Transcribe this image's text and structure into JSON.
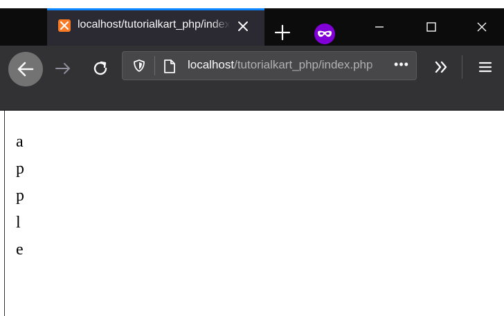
{
  "tab": {
    "title": "localhost/tutorialkart_php/index.php",
    "favicon": "xampp-icon"
  },
  "urlbar": {
    "host": "localhost",
    "path": "/tutorialkart_php/index.php",
    "more_label": "•••"
  },
  "icons": {
    "back": "back-arrow-icon",
    "forward": "forward-arrow-icon",
    "reload": "reload-icon",
    "shield": "tracking-shield-icon",
    "page": "page-icon",
    "overflow": "chevron-double-right-icon",
    "menu": "hamburger-menu-icon",
    "private": "private-browsing-mask-icon"
  },
  "colors": {
    "tab_accent": "#0a84ff",
    "private_badge": "#8000d7",
    "favicon_bg": "#fb7a24"
  },
  "page": {
    "lines": [
      "a",
      "p",
      "p",
      "l",
      "e"
    ]
  }
}
